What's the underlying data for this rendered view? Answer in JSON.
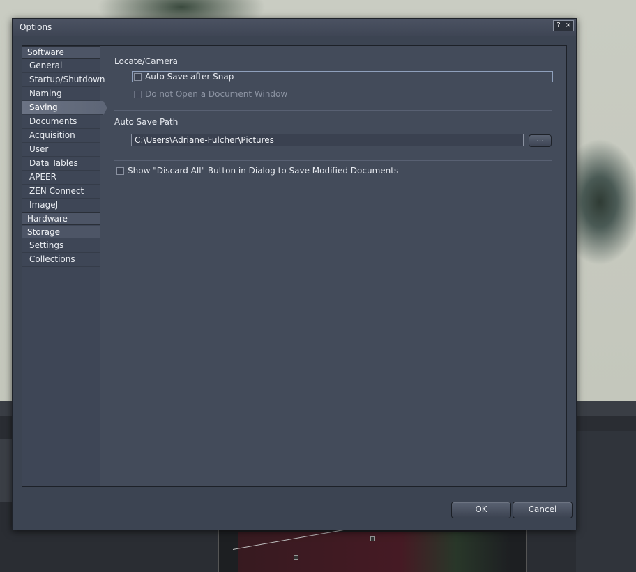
{
  "dialog": {
    "title": "Options",
    "help_label": "?",
    "close_label": "×"
  },
  "sidebar": {
    "categories": {
      "software": "Software",
      "hardware": "Hardware",
      "storage": "Storage"
    },
    "software_items": [
      {
        "label": "General"
      },
      {
        "label": "Startup/Shutdown"
      },
      {
        "label": "Naming"
      },
      {
        "label": "Saving",
        "selected": true
      },
      {
        "label": "Documents"
      },
      {
        "label": "Acquisition"
      },
      {
        "label": "User"
      },
      {
        "label": "Data Tables"
      },
      {
        "label": "APEER"
      },
      {
        "label": "ZEN Connect"
      },
      {
        "label": "ImageJ"
      }
    ],
    "storage_items": [
      {
        "label": "Settings"
      },
      {
        "label": "Collections"
      }
    ]
  },
  "panel": {
    "locate_camera": {
      "heading": "Locate/Camera",
      "auto_save_after_snap": {
        "label": "Auto Save after Snap",
        "checked": false
      },
      "do_not_open_document": {
        "label": "Do not Open a Document Window",
        "checked": false,
        "disabled": true
      }
    },
    "auto_save_path": {
      "heading": "Auto Save Path",
      "value": "C:\\Users\\Adriane-Fulcher\\Pictures",
      "browse_label": "..."
    },
    "discard_all": {
      "label": "Show \"Discard All\" Button in Dialog to Save Modified Documents",
      "checked": false
    }
  },
  "buttons": {
    "ok": "OK",
    "cancel": "Cancel"
  }
}
